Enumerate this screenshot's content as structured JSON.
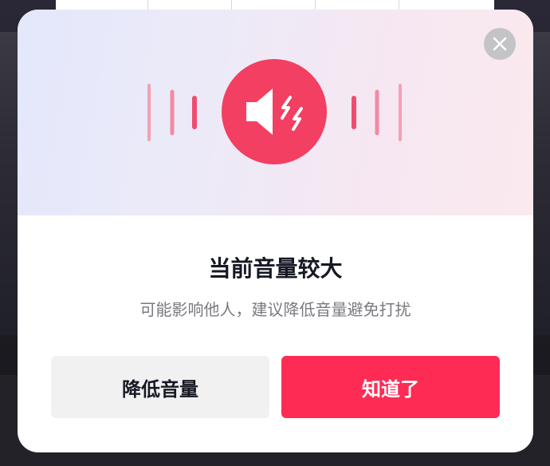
{
  "dialog": {
    "title": "当前音量较大",
    "subtitle": "可能影响他人，建议降低音量避免打扰",
    "buttons": {
      "lower_volume": "降低音量",
      "acknowledge": "知道了"
    },
    "icons": {
      "close": "close-icon",
      "hero": "speaker-loud-icon",
      "waves": "sound-wave-icon"
    },
    "colors": {
      "accent": "#fe2c55",
      "hero_circle": "#f23f62",
      "close_bg": "#c3c3c8",
      "secondary_button_bg": "#f1f1f2",
      "title": "#161823",
      "subtitle": "#7a7a80"
    }
  }
}
